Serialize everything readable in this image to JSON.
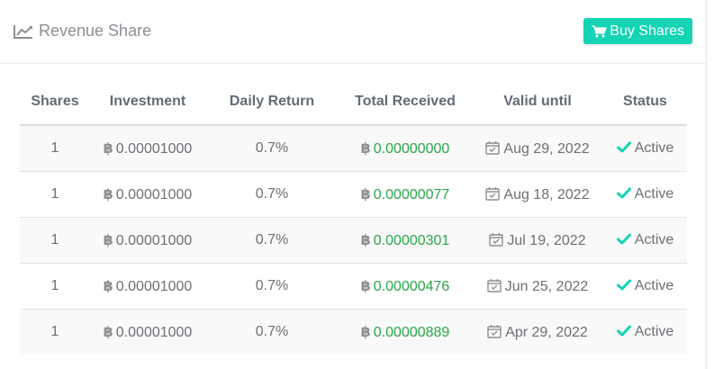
{
  "header": {
    "title": "Revenue Share",
    "title_icon": "line-chart-icon",
    "buy_button_label": "Buy Shares",
    "buy_button_icon": "shopping-cart-icon"
  },
  "colors": {
    "accent": "#14d4b4",
    "received_green": "#27a847",
    "status_check": "#14d4b4"
  },
  "table": {
    "columns": [
      "Shares",
      "Investment",
      "Daily Return",
      "Total Received",
      "Valid until",
      "Status"
    ],
    "currency_symbol": "฿",
    "rows": [
      {
        "shares": "1",
        "investment": "0.00001000",
        "daily_return": "0.7%",
        "total_received": "0.00000000",
        "valid_until": "Aug 29, 2022",
        "status": "Active"
      },
      {
        "shares": "1",
        "investment": "0.00001000",
        "daily_return": "0.7%",
        "total_received": "0.00000077",
        "valid_until": "Aug 18, 2022",
        "status": "Active"
      },
      {
        "shares": "1",
        "investment": "0.00001000",
        "daily_return": "0.7%",
        "total_received": "0.00000301",
        "valid_until": "Jul 19, 2022",
        "status": "Active"
      },
      {
        "shares": "1",
        "investment": "0.00001000",
        "daily_return": "0.7%",
        "total_received": "0.00000476",
        "valid_until": "Jun 25, 2022",
        "status": "Active"
      },
      {
        "shares": "1",
        "investment": "0.00001000",
        "daily_return": "0.7%",
        "total_received": "0.00000889",
        "valid_until": "Apr 29, 2022",
        "status": "Active"
      }
    ]
  }
}
